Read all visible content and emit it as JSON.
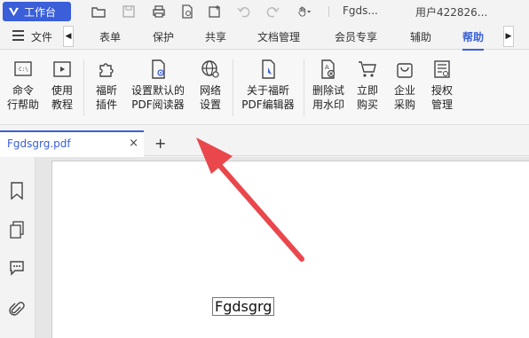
{
  "titlebar": {
    "workbench_label": "工作台",
    "filename": "Fgds...",
    "user": "用户422826..."
  },
  "menu": {
    "file_label": "文件",
    "tabs": [
      "表单",
      "保护",
      "共享",
      "文档管理",
      "会员专享",
      "辅助",
      "帮助"
    ],
    "active_tab": "帮助"
  },
  "ribbon": {
    "buttons": [
      {
        "label1": "命令",
        "label2": "行帮助",
        "icon": "command-help-icon"
      },
      {
        "label1": "使用",
        "label2": "教程",
        "icon": "tutorial-icon"
      },
      {
        "label1": "福昕",
        "label2": "插件",
        "icon": "plugin-icon"
      },
      {
        "label1": "设置默认的",
        "label2": "PDF阅读器",
        "icon": "default-reader-icon"
      },
      {
        "label1": "网络",
        "label2": "设置",
        "icon": "network-settings-icon"
      },
      {
        "label1": "关于福昕",
        "label2": "PDF编辑器",
        "icon": "about-icon"
      },
      {
        "label1": "删除试",
        "label2": "用水印",
        "icon": "remove-watermark-icon"
      },
      {
        "label1": "立即",
        "label2": "购买",
        "icon": "cart-icon"
      },
      {
        "label1": "企业",
        "label2": "采购",
        "icon": "bag-icon"
      },
      {
        "label1": "授权",
        "label2": "管理",
        "icon": "license-icon"
      }
    ]
  },
  "document": {
    "tab_name": "Fgdsgrg.pdf",
    "close_symbol": "×",
    "add_symbol": "+",
    "page_text": "Fgdsgrg"
  },
  "colors": {
    "accent": "#3a5fd8",
    "highlight": "#e9474c"
  }
}
